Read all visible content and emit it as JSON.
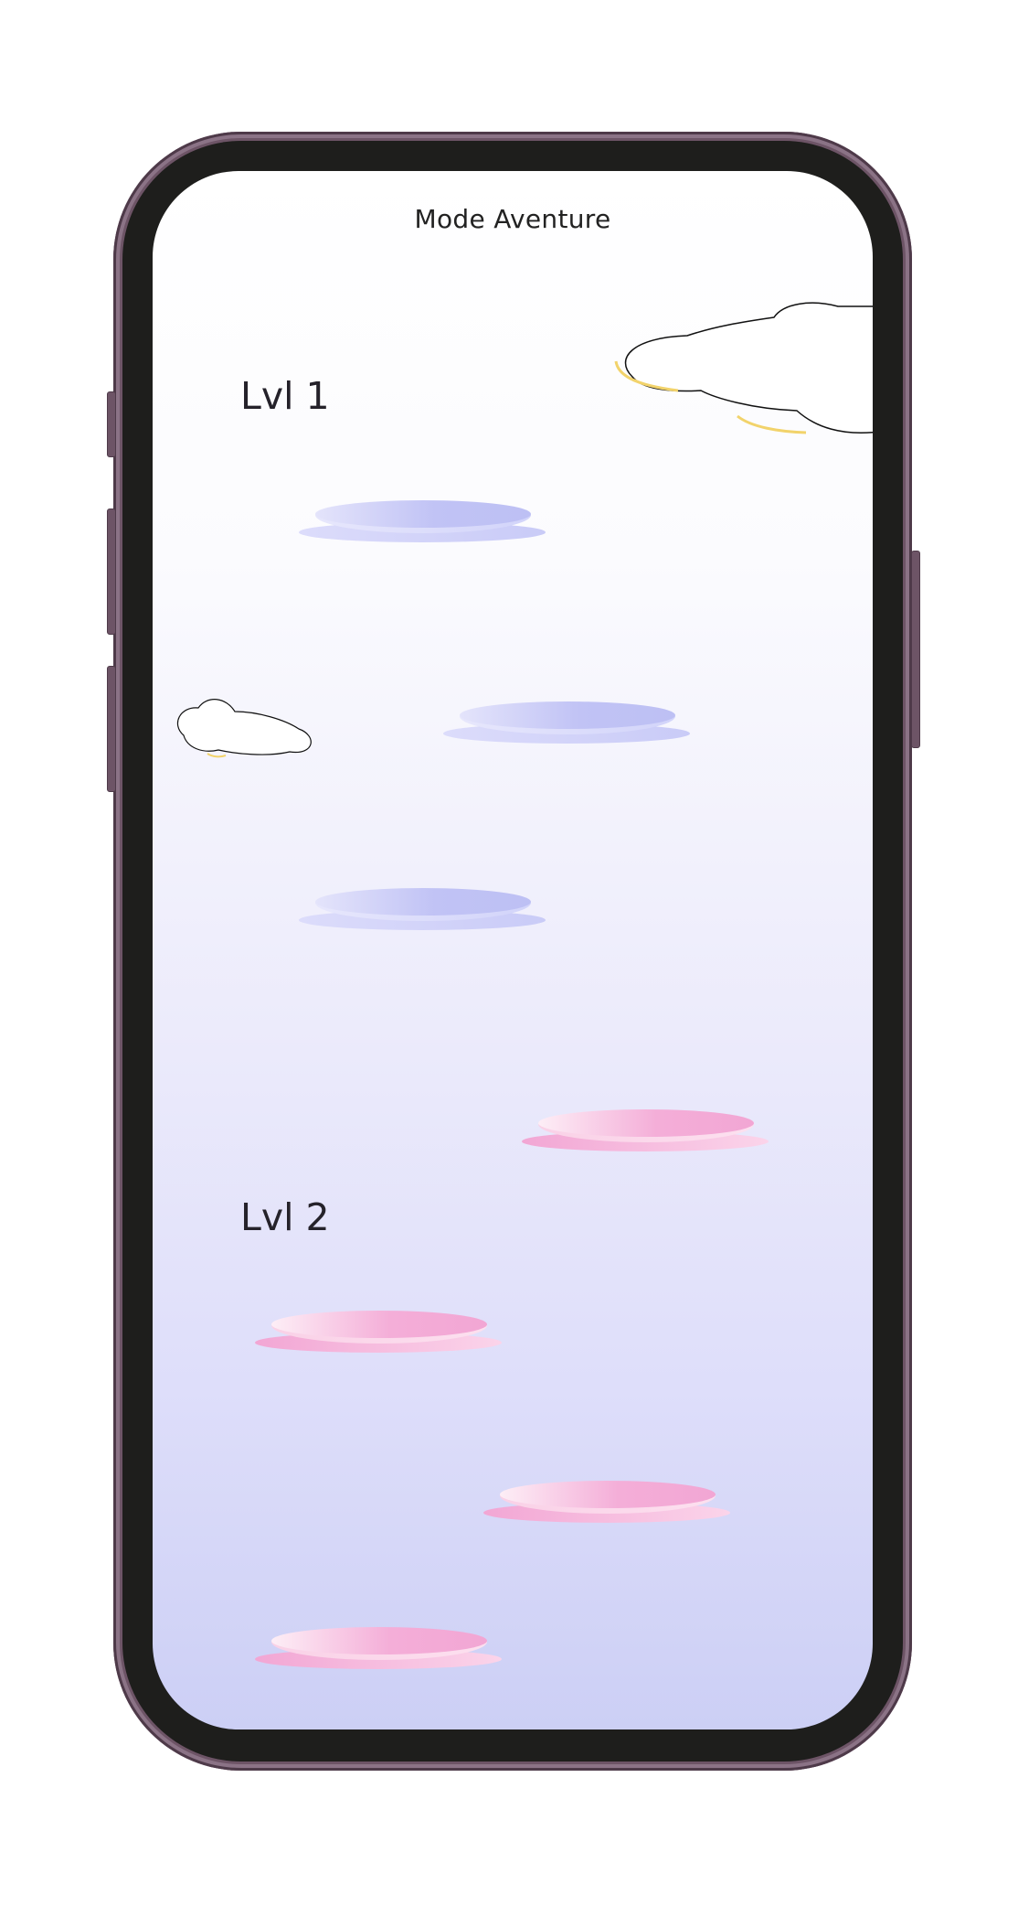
{
  "screen": {
    "title": "Mode Aventure",
    "levels": [
      {
        "label": "Lvl 1",
        "color": "#c1c3f5",
        "steps": 3
      },
      {
        "label": "Lvl 2",
        "color": "#f2a6d4",
        "steps": 4
      }
    ]
  },
  "icons": [
    "cloud-icon",
    "cloud-icon"
  ],
  "colors": {
    "frame": "#6d5466",
    "bezel": "#1e1e1c",
    "blue_pad": "#c1c3f5",
    "pink_pad": "#f2a6d4"
  }
}
